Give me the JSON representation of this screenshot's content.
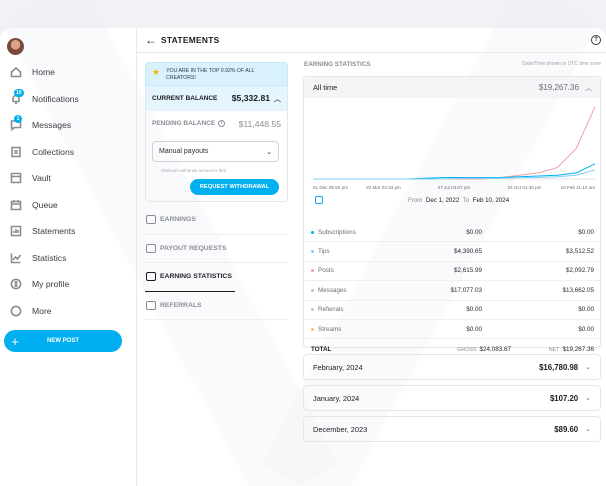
{
  "sidebar": {
    "items": [
      {
        "label": "Home",
        "icon": "home-icon"
      },
      {
        "label": "Notifications",
        "icon": "bell-icon",
        "badge": "10"
      },
      {
        "label": "Messages",
        "icon": "message-icon",
        "badge": "1"
      },
      {
        "label": "Collections",
        "icon": "bookmark-icon"
      },
      {
        "label": "Vault",
        "icon": "vault-icon"
      },
      {
        "label": "Queue",
        "icon": "calendar-icon"
      },
      {
        "label": "Statements",
        "icon": "statements-icon"
      },
      {
        "label": "Statistics",
        "icon": "chart-icon"
      },
      {
        "label": "My profile",
        "icon": "profile-icon"
      },
      {
        "label": "More",
        "icon": "more-icon"
      }
    ],
    "new_post": "NEW POST"
  },
  "header": {
    "title": "STATEMENTS"
  },
  "left": {
    "banner": "YOU ARE IN THE TOP 0.92% OF ALL CREATORS!",
    "current_balance_label": "CURRENT BALANCE",
    "current_balance": "$5,332.81",
    "pending_label": "PENDING BALANCE",
    "pending_balance": "$11,448.55",
    "payout_select": "Manual payouts",
    "min_note": "Minimum withdraw amount is $20",
    "withdraw_button": "REQUEST WITHDRAWAL",
    "menu": [
      "EARNINGS",
      "PAYOUT REQUESTS",
      "EARNING STATISTICS",
      "REFERRALS"
    ]
  },
  "right": {
    "heading": "EARNING STATISTICS",
    "timezone_note": "Date/Time shown in UTC time zone",
    "period_label": "All time",
    "period_amount": "$19,267.36",
    "date_from_label": "From",
    "date_from": "Dec 1, 2022",
    "date_to_label": "To",
    "date_to": "Feb 10, 2024",
    "rows": [
      {
        "name": "Subscriptions",
        "gross": "$0.00",
        "net": "$0.00",
        "color": "#00aff0"
      },
      {
        "name": "Tips",
        "gross": "$4,390.65",
        "net": "$3,512.52",
        "color": "#7ed2f5"
      },
      {
        "name": "Posts",
        "gross": "$2,615.99",
        "net": "$2,092.79",
        "color": "#f0a0a0"
      },
      {
        "name": "Messages",
        "gross": "$17,077.03",
        "net": "$13,662.05",
        "color": "#c0c4cc"
      },
      {
        "name": "Referrals",
        "gross": "$0.00",
        "net": "$0.00",
        "color": "#c0c4cc"
      },
      {
        "name": "Streams",
        "gross": "$0.00",
        "net": "$0.00",
        "color": "#f7c85a"
      }
    ],
    "total_label": "TOTAL",
    "gross_label": "GROSS",
    "gross_total": "$24,083.67",
    "net_label": "NET",
    "net_total": "$19,267.36",
    "months": [
      {
        "label": "February, 2024",
        "amount": "$16,780.98"
      },
      {
        "label": "January, 2024",
        "amount": "$107.20"
      },
      {
        "label": "December, 2023",
        "amount": "$89.60"
      }
    ]
  },
  "chart_data": {
    "type": "line",
    "x_ticks": [
      "01 Dec 05:50 pm",
      "20 Mar 04:33 pm",
      "07 Jul 03:07 pm",
      "24 Oct 01:40 pm",
      "10 Feb 11:14 am"
    ],
    "series": [
      {
        "color": "#f0a0a0",
        "values": [
          0,
          0,
          0,
          0,
          0,
          0,
          0,
          0,
          0,
          0,
          0.02,
          0.05,
          0.08,
          0.15,
          0.4,
          0.95
        ]
      },
      {
        "color": "#00aff0",
        "values": [
          0,
          0,
          0,
          0,
          0,
          0,
          0.01,
          0.02,
          0.02,
          0.02,
          0.02,
          0.03,
          0.04,
          0.05,
          0.08,
          0.2
        ]
      },
      {
        "color": "#7ed2f5",
        "values": [
          0,
          0,
          0,
          0,
          0,
          0,
          0,
          0,
          0.01,
          0.01,
          0.01,
          0.02,
          0.02,
          0.03,
          0.05,
          0.12
        ]
      }
    ]
  }
}
